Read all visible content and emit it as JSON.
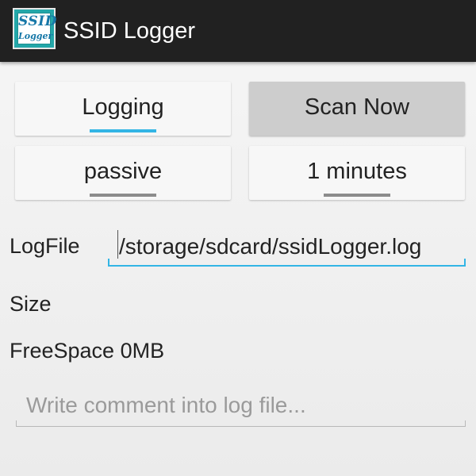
{
  "app": {
    "icon_line1": "SSID",
    "icon_line2": "Logger",
    "title": "SSID Logger"
  },
  "controls": {
    "logging_label": "Logging",
    "scan_now_label": "Scan Now",
    "mode_label": "passive",
    "interval_label": "1 minutes"
  },
  "logfile": {
    "label": "LogFile",
    "value": "/storage/sdcard/ssidLogger.log"
  },
  "size": {
    "label": "Size"
  },
  "freespace": {
    "text": "FreeSpace 0MB"
  },
  "comment": {
    "placeholder": "Write comment into log file..."
  },
  "colors": {
    "accent": "#33b5e5",
    "actionbar": "#212121",
    "icon_bg": "#23a7a9"
  }
}
